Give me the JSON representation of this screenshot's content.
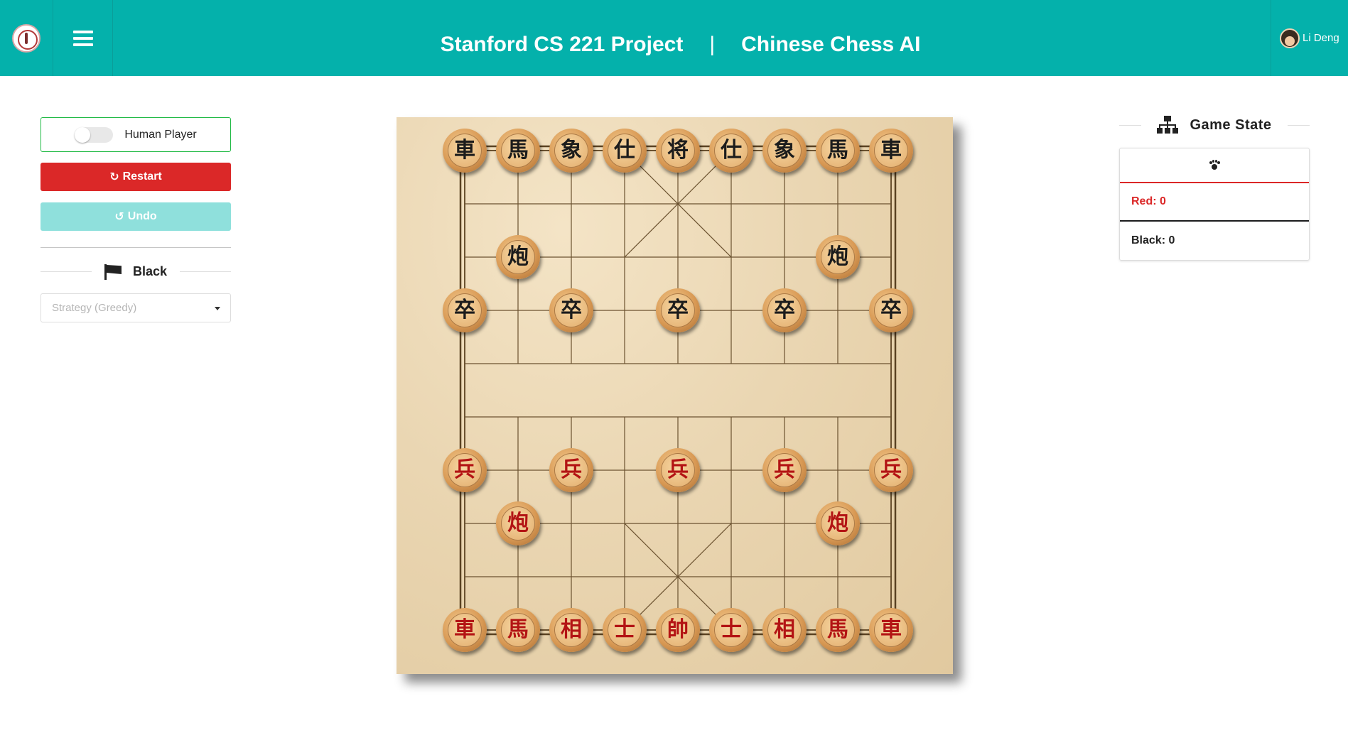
{
  "header": {
    "title_left": "Stanford CS 221 Project",
    "separator": "|",
    "title_right": "Chinese Chess AI",
    "user_name": "Li Deng",
    "bg_color": "#04b1ab"
  },
  "controls": {
    "human_player_label": "Human Player",
    "human_player_on": false,
    "restart_label": "Restart",
    "undo_label": "Undo",
    "restart_icon": "refresh-icon",
    "undo_icon": "undo-icon",
    "player_label": "Black",
    "player_icon": "flag-icon",
    "strategy_placeholder": "Strategy (Greedy)"
  },
  "game_state": {
    "title": "Game State",
    "title_icon": "sitemap-icon",
    "tab_icon": "paw-icon",
    "red_score": "Red: 0",
    "black_score": "Black: 0"
  },
  "colors": {
    "accent": "#04b1ab",
    "restart": "#db2828",
    "undo": "#8fe0dc",
    "red_piece_text": "#b31414",
    "black_piece_text": "#1c1c1c"
  },
  "board": {
    "files": 9,
    "ranks": 10,
    "pieces": [
      {
        "char": "車",
        "side": "black",
        "file": 0,
        "rank": 0
      },
      {
        "char": "馬",
        "side": "black",
        "file": 1,
        "rank": 0
      },
      {
        "char": "象",
        "side": "black",
        "file": 2,
        "rank": 0
      },
      {
        "char": "仕",
        "side": "black",
        "file": 3,
        "rank": 0
      },
      {
        "char": "将",
        "side": "black",
        "file": 4,
        "rank": 0
      },
      {
        "char": "仕",
        "side": "black",
        "file": 5,
        "rank": 0
      },
      {
        "char": "象",
        "side": "black",
        "file": 6,
        "rank": 0
      },
      {
        "char": "馬",
        "side": "black",
        "file": 7,
        "rank": 0
      },
      {
        "char": "車",
        "side": "black",
        "file": 8,
        "rank": 0
      },
      {
        "char": "炮",
        "side": "black",
        "file": 1,
        "rank": 2
      },
      {
        "char": "炮",
        "side": "black",
        "file": 7,
        "rank": 2
      },
      {
        "char": "卒",
        "side": "black",
        "file": 0,
        "rank": 3
      },
      {
        "char": "卒",
        "side": "black",
        "file": 2,
        "rank": 3
      },
      {
        "char": "卒",
        "side": "black",
        "file": 4,
        "rank": 3
      },
      {
        "char": "卒",
        "side": "black",
        "file": 6,
        "rank": 3
      },
      {
        "char": "卒",
        "side": "black",
        "file": 8,
        "rank": 3
      },
      {
        "char": "兵",
        "side": "red",
        "file": 0,
        "rank": 6
      },
      {
        "char": "兵",
        "side": "red",
        "file": 2,
        "rank": 6
      },
      {
        "char": "兵",
        "side": "red",
        "file": 4,
        "rank": 6
      },
      {
        "char": "兵",
        "side": "red",
        "file": 6,
        "rank": 6
      },
      {
        "char": "兵",
        "side": "red",
        "file": 8,
        "rank": 6
      },
      {
        "char": "炮",
        "side": "red",
        "file": 1,
        "rank": 7
      },
      {
        "char": "炮",
        "side": "red",
        "file": 7,
        "rank": 7
      },
      {
        "char": "車",
        "side": "red",
        "file": 0,
        "rank": 9
      },
      {
        "char": "馬",
        "side": "red",
        "file": 1,
        "rank": 9
      },
      {
        "char": "相",
        "side": "red",
        "file": 2,
        "rank": 9
      },
      {
        "char": "士",
        "side": "red",
        "file": 3,
        "rank": 9
      },
      {
        "char": "帥",
        "side": "red",
        "file": 4,
        "rank": 9
      },
      {
        "char": "士",
        "side": "red",
        "file": 5,
        "rank": 9
      },
      {
        "char": "相",
        "side": "red",
        "file": 6,
        "rank": 9
      },
      {
        "char": "馬",
        "side": "red",
        "file": 7,
        "rank": 9
      },
      {
        "char": "車",
        "side": "red",
        "file": 8,
        "rank": 9
      }
    ]
  }
}
